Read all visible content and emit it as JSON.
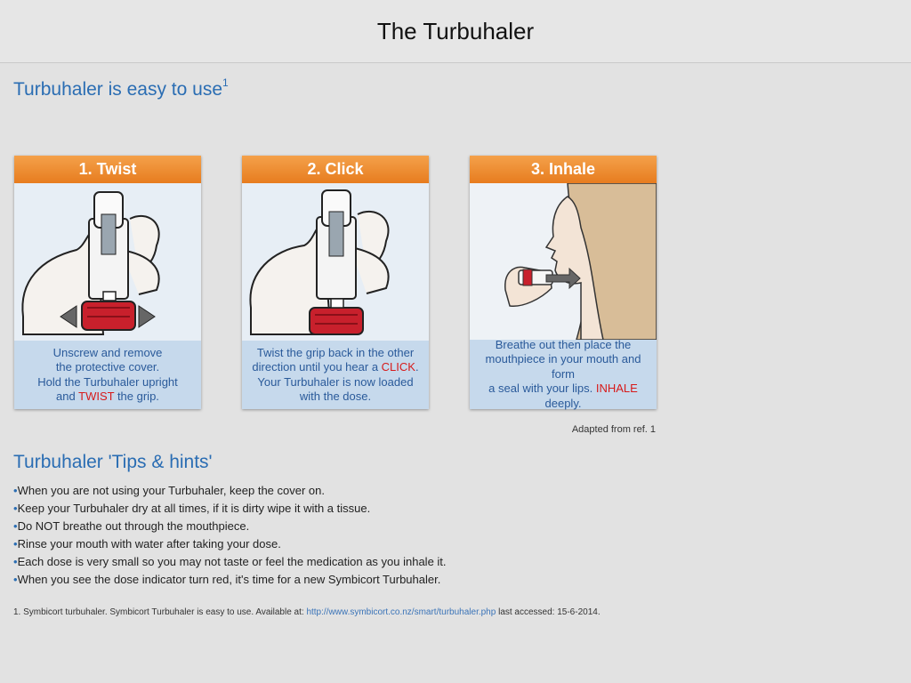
{
  "header": {
    "title": "The Turbuhaler"
  },
  "intro": {
    "title": "Turbuhaler is easy to use",
    "ref": "1"
  },
  "steps": [
    {
      "title": "1. Twist",
      "lines": [
        "Unscrew and remove",
        "the protective cover.",
        "Hold the Turbuhaler upright"
      ],
      "pre": "and ",
      "highlight": "TWIST",
      "post": " the grip."
    },
    {
      "title": "2. Click",
      "line1": "Twist the grip back in the other",
      "pre": "direction until you hear a ",
      "highlight": "CLICK",
      "post": ".",
      "lines": [
        "Your Turbuhaler is now loaded",
        "with the dose."
      ]
    },
    {
      "title": "3. Inhale",
      "lines": [
        "Breathe out then place the",
        "mouthpiece in your mouth and form"
      ],
      "pre": "a seal with your lips. ",
      "highlight": "INHALE",
      "post": " deeply."
    }
  ],
  "adapted": "Adapted from ref. 1",
  "tips": {
    "title": "Turbuhaler 'Tips & hints'",
    "bullet": "•",
    "items": [
      "When you are not using your Turbuhaler, keep the cover on.",
      "Keep your Turbuhaler dry at all times, if it is dirty wipe it with a tissue.",
      "Do NOT breathe out through the mouthpiece.",
      "Rinse your mouth with water after taking your dose.",
      "Each dose is very small so you may not taste or feel the medication as you inhale it.",
      "When you see the dose indicator turn red, it's time for a new Symbicort Turbuhaler."
    ]
  },
  "footnote": {
    "pre": "1. Symbicort turbuhaler. Symbicort Turbuhaler is easy to use. Available at: ",
    "link": "http://www.symbicort.co.nz/smart/turbuhaler.php",
    "post": " last accessed: 15-6-2014."
  }
}
